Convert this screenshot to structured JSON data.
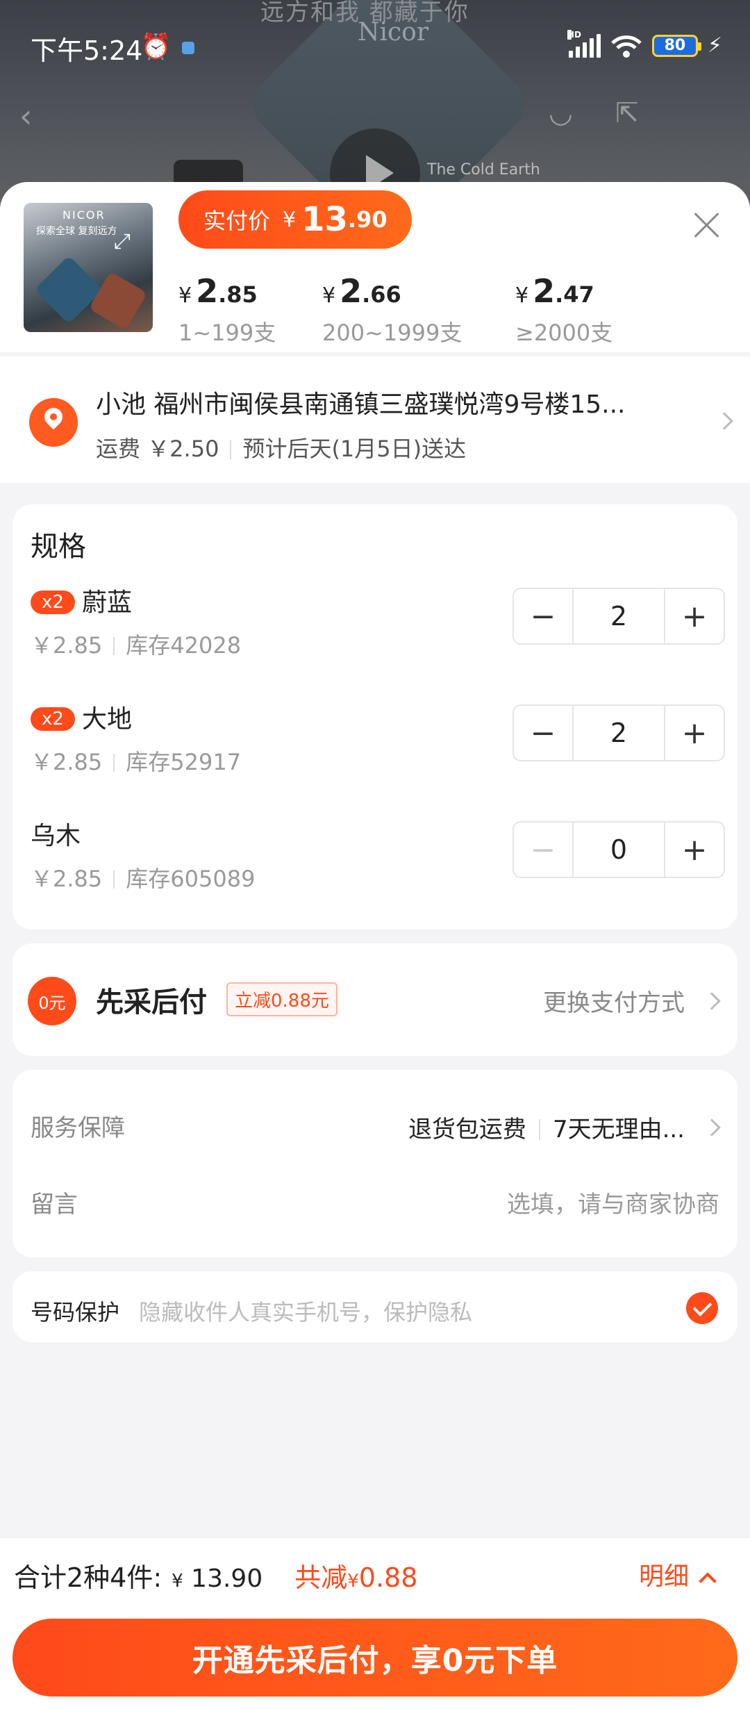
{
  "status_bar": {
    "time": "下午5:24",
    "battery": "80",
    "network": "HD"
  },
  "background": {
    "slogan": "远方和我 都藏于你",
    "brand": "Nicor",
    "caption": "The Cold Earth"
  },
  "product": {
    "thumb_brand": "NICOR",
    "thumb_tagline": "探索全球 复刻远方",
    "paid_label": "实付价",
    "paid_currency": "¥",
    "paid_int": "13",
    "paid_dec": ".90",
    "tiers": [
      {
        "currency": "¥",
        "int": "2",
        "dec": ".85",
        "range": "1~199支"
      },
      {
        "currency": "¥",
        "int": "2",
        "dec": ".66",
        "range": "200~1999支"
      },
      {
        "currency": "¥",
        "int": "2",
        "dec": ".47",
        "range": "≥2000支"
      }
    ]
  },
  "address": {
    "line": "小池 福州市闽侯县南通镇三盛璞悦湾9号楼15...",
    "shipping": "运费 ￥2.50",
    "eta": "预计后天(1月5日)送达"
  },
  "spec": {
    "title": "规格",
    "items": [
      {
        "badge": "x2",
        "name": "蔚蓝",
        "price": "￥2.85",
        "stock": "库存42028",
        "qty": "2",
        "minus": "−",
        "plus": "+"
      },
      {
        "badge": "x2",
        "name": "大地",
        "price": "￥2.85",
        "stock": "库存52917",
        "qty": "2",
        "minus": "−",
        "plus": "+"
      },
      {
        "badge": "",
        "name": "乌木",
        "price": "￥2.85",
        "stock": "库存605089",
        "qty": "0",
        "minus": "−",
        "plus": "+"
      }
    ]
  },
  "payment": {
    "icon_text": "0元",
    "title": "先采后付",
    "tag": "立减0.88元",
    "change": "更换支付方式"
  },
  "service": {
    "label": "服务保障",
    "value1": "退货包运费",
    "value2": "7天无理由..."
  },
  "message": {
    "label": "留言",
    "placeholder": "选填，请与商家协商"
  },
  "number_protect": {
    "label": "号码保护",
    "hint": "隐藏收件人真实手机号，保护隐私",
    "checked": true
  },
  "bottom": {
    "summary": "合计2种4件:",
    "total_currency": "¥",
    "total": "13.90",
    "discount_label": "共减",
    "discount_currency": "¥",
    "discount": "0.88",
    "detail": "明细",
    "submit": "开通先采后付，享0元下单"
  },
  "colors": {
    "accent": "#ff4a1a",
    "background": "#f4f4f6"
  }
}
